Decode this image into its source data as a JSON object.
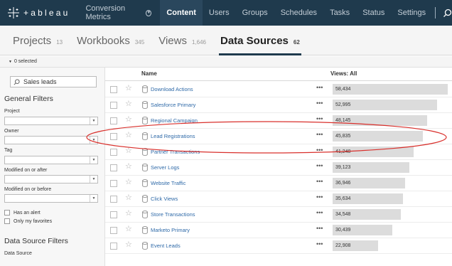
{
  "nav": {
    "logo_text": "+ableau",
    "site": "Conversion Metrics",
    "links": [
      {
        "label": "Content",
        "active": true
      },
      {
        "label": "Users",
        "active": false
      },
      {
        "label": "Groups",
        "active": false
      },
      {
        "label": "Schedules",
        "active": false
      },
      {
        "label": "Tasks",
        "active": false
      },
      {
        "label": "Status",
        "active": false
      },
      {
        "label": "Settings",
        "active": false
      }
    ]
  },
  "tabs": [
    {
      "label": "Projects",
      "count": "13"
    },
    {
      "label": "Workbooks",
      "count": "345"
    },
    {
      "label": "Views",
      "count": "1,646"
    },
    {
      "label": "Data Sources",
      "count": "62"
    }
  ],
  "selection": {
    "text": "0 selected"
  },
  "sidebar": {
    "search_value": "Sales leads",
    "general_filters": "General Filters",
    "project_label": "Project",
    "owner_label": "Owner",
    "tag_label": "Tag",
    "modified_after_label": "Modified on or after",
    "modified_before_label": "Modified on or before",
    "has_alert_label": "Has an alert",
    "favorites_label": "Only my favorites",
    "ds_filters": "Data Source Filters",
    "ds_label": "Data Source"
  },
  "table": {
    "name_header": "Name",
    "views_header": "Views: All",
    "max_views": 58434,
    "rows": [
      {
        "name": "Download Actions",
        "views": "58,434",
        "value": 58434
      },
      {
        "name": "Salesforce Primary",
        "views": "52,995",
        "value": 52995
      },
      {
        "name": "Regional Campaign",
        "views": "48,145",
        "value": 48145
      },
      {
        "name": "Lead Registrations",
        "views": "45,835",
        "value": 45835
      },
      {
        "name": "Partner Transactions",
        "views": "41,248",
        "value": 41248
      },
      {
        "name": "Server Logs",
        "views": "39,123",
        "value": 39123
      },
      {
        "name": "Website Traffic",
        "views": "36,946",
        "value": 36946
      },
      {
        "name": "Click Views",
        "views": "35,634",
        "value": 35634
      },
      {
        "name": "Store Transactions",
        "views": "34,548",
        "value": 34548
      },
      {
        "name": "Marketo Primary",
        "views": "30,439",
        "value": 30439
      },
      {
        "name": "Event Leads",
        "views": "22,908",
        "value": 22908
      }
    ]
  },
  "colors": {
    "nav_bg": "#1f3a4d",
    "link": "#2f6aa8",
    "highlight": "#d9302c"
  }
}
